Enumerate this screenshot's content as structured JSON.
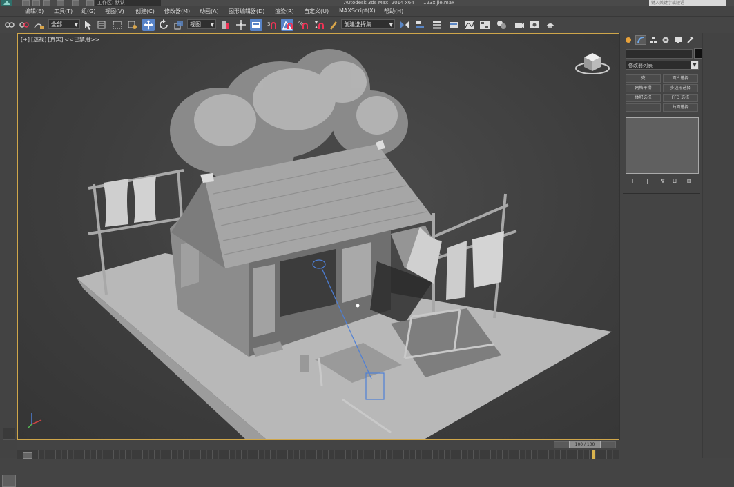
{
  "titlebar": {
    "workspace": "工作区: 默认",
    "title": "Autodesk 3ds Max  2014 x64      123xijie.max",
    "search_placeholder": "键入关键字或短语"
  },
  "menu": [
    {
      "label": "编辑(E)"
    },
    {
      "label": "工具(T)"
    },
    {
      "label": "组(G)"
    },
    {
      "label": "视图(V)"
    },
    {
      "label": "创建(C)"
    },
    {
      "label": "修改器(M)"
    },
    {
      "label": "动画(A)"
    },
    {
      "label": "图形编辑器(D)"
    },
    {
      "label": "渲染(R)"
    },
    {
      "label": "自定义(U)"
    },
    {
      "label": "MAXScript(X)"
    },
    {
      "label": "帮助(H)"
    }
  ],
  "toolbar": {
    "selection_filter": "全部",
    "reference_coord": "视图",
    "named_selection": "创建选择集",
    "icons": [
      "link-icon",
      "unlink-icon",
      "bind-space-warp-icon",
      "select-object-icon",
      "select-by-name-icon",
      "rectangle-region-icon",
      "window-crossing-icon",
      "select-move-icon",
      "select-rotate-icon",
      "select-scale-icon",
      "pivot-icon",
      "select-manipulate-icon",
      "keyboard-shortcut-icon",
      "snap-3d-icon",
      "angle-snap-icon",
      "percent-snap-icon",
      "spinner-snap-icon",
      "edit-named-selection-icon",
      "mirror-icon",
      "align-icon",
      "layer-manager-icon",
      "ribbon-icon",
      "curve-editor-icon",
      "schematic-view-icon",
      "material-editor-icon",
      "render-setup-icon",
      "rendered-frame-icon",
      "render-production-icon"
    ]
  },
  "viewport": {
    "label_parts": [
      "[+]",
      "[透视]",
      "[真实]",
      "<<已禁用>>"
    ],
    "frame_color": "#cfa64a"
  },
  "command_panel": {
    "tabs": [
      "create-tab-icon",
      "modify-tab-icon",
      "hierarchy-tab-icon",
      "motion-tab-icon",
      "display-tab-icon",
      "utilities-tab-icon"
    ],
    "active_tab": 1,
    "modifier_list": "修改器列表",
    "buttons": [
      "壳",
      "面片选择",
      "网格平滑",
      "多边形选择",
      "体积选择",
      "FFD 选择",
      "",
      "曲面选择"
    ],
    "stack_tools": [
      "pin-stack-icon",
      "show-end-result-icon",
      "make-unique-icon",
      "remove-modifier-icon",
      "configure-modifier-sets-icon"
    ]
  },
  "timeline": {
    "slider_text": "100 / 100",
    "current_frame": 100,
    "total_frames": 100
  }
}
